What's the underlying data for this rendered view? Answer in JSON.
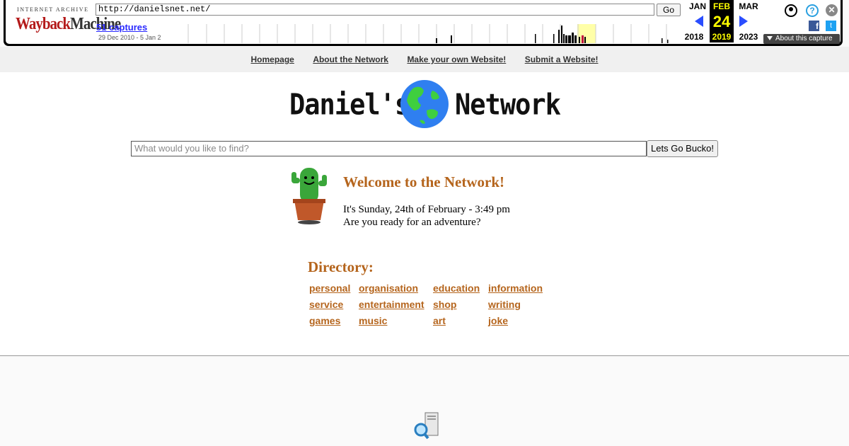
{
  "toolbar": {
    "logo_top": "INTERNET ARCHIVE",
    "logo_wayback": "Wayback",
    "logo_machine": "Machine",
    "url": "http://danielsnet.net/",
    "go_label": "Go",
    "captures_label": "51 captures",
    "date_range": "29 Dec 2010 - 5 Jan 2",
    "prev_month": "JAN",
    "cur_month": "FEB",
    "next_month": "MAR",
    "prev_year": "2018",
    "cur_year": "2019",
    "next_year": "2023",
    "cur_day": "24",
    "about_label": "About this capture",
    "help_glyph": "?",
    "close_glyph": "✕",
    "fb_glyph": "f",
    "tw_glyph": "t",
    "icons": [
      "user-icon",
      "help-icon",
      "close-icon",
      "facebook-icon",
      "twitter-icon"
    ],
    "colors": {
      "arrow": "#2a4dff",
      "current_date": "#ffff00",
      "captures_link": "#2a2aff"
    }
  },
  "nav": {
    "items": [
      "Homepage",
      "About the Network",
      "Make your own Website!",
      "Submit a Website!"
    ]
  },
  "logo": {
    "left": "Daniel's",
    "right": "Network"
  },
  "search": {
    "placeholder": "What would you like to find?",
    "button": "Lets Go Bucko!"
  },
  "welcome": {
    "title": "Welcome to the Network!",
    "line1": "It's Sunday, 24th of February - 3:49 pm",
    "line2": "Are you ready for an adventure?"
  },
  "directory": {
    "title": "Directory:",
    "links": [
      [
        "personal",
        "organisation",
        "education",
        "information"
      ],
      [
        "service",
        "entertainment",
        "shop",
        "writing"
      ],
      [
        "games",
        "music",
        "art",
        "joke"
      ]
    ]
  },
  "colors": {
    "accent": "#b5651d"
  }
}
